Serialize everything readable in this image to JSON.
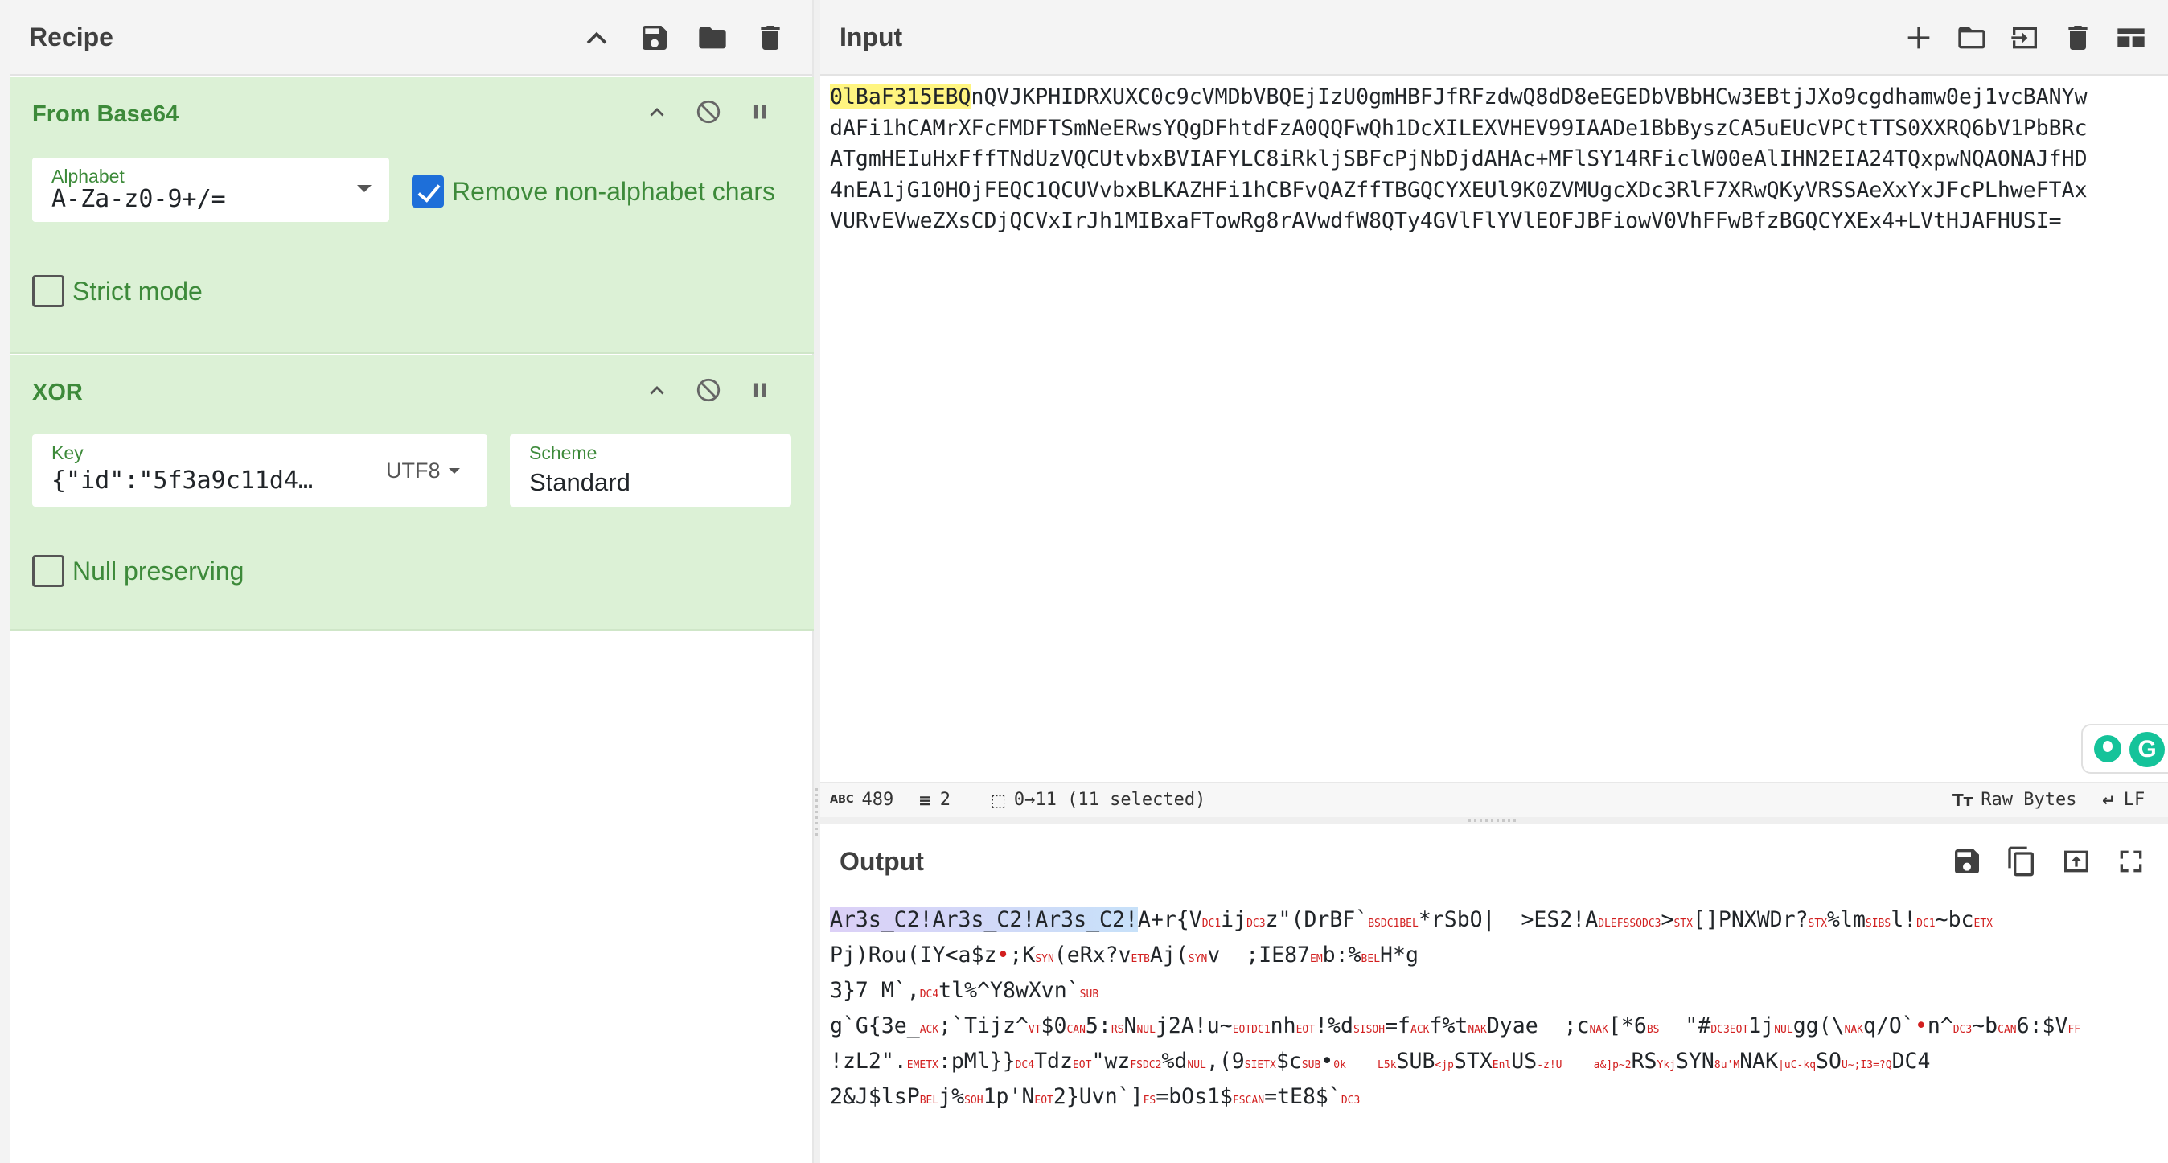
{
  "recipe": {
    "title": "Recipe",
    "operations": [
      {
        "name": "From Base64",
        "alphabet_label": "Alphabet",
        "alphabet_value": "A-Za-z0-9+/=",
        "remove_non_alphabet_label": "Remove non-alphabet chars",
        "remove_non_alphabet_checked": true,
        "strict_mode_label": "Strict mode",
        "strict_mode_checked": false
      },
      {
        "name": "XOR",
        "key_label": "Key",
        "key_value": "{\"id\":\"5f3a9c11d4…",
        "key_encoding": "UTF8",
        "scheme_label": "Scheme",
        "scheme_value": "Standard",
        "null_preserving_label": "Null preserving",
        "null_preserving_checked": false
      }
    ]
  },
  "input": {
    "title": "Input",
    "highlighted": "0lBaF315EBQ",
    "first_line_rest": "nQVJKPHIDRXUXC0c9cVMDbVBQEjIzU0gmHBFJfRFzdwQ8dD8eEGEDbVBbHCw3EBtjJXo9cgdhamw0ej1vcBANYw",
    "lines": [
      "dAFi1hCAMrXFcFMDFTSmNeERwsYQgDFhtdFzA0QQFwQh1DcXILEXVHEV99IAADe1BbByszCA5uEUcVPCtTTS0XXRQ6bV1PbBRc",
      "ATgmHEIuHxFffTNdUzVQCUtvbxBVIAFYLC8iRkljSBFcPjNbDjdAHAc+MFlSY14RFiclW00eAlIHN2EIA24TQxpwNQAONAJfHD",
      "4nEA1jG10HOjFEQC1QCUVvbxBLKAZHFi1hCBFvQAZffTBGQCYXEUl9K0ZVMUgcXDc3RlF7XRwQKyVRSSAeXxYxJFcPLhweFTAx",
      "VURvEVweZXsCDjQCVxIrJh1MIBxaFTowRg8rAVwdfW8QTy4GVlFlYVlEOFJBFiowV0VhFFwBfzBGQCYXEx4+LVtHJAFHUSI="
    ],
    "status": {
      "char_count": "489",
      "line_count": "2",
      "selection": "0→11 (11 selected)",
      "encoding_label": "Raw Bytes",
      "eol_label": "LF"
    }
  },
  "output": {
    "title": "Output",
    "highlighted": "Ar3s_C2!Ar3s_C2!Ar3s_C2!",
    "lines": [
      [
        "A+r{V",
        "DC1",
        "ij",
        "DC3",
        "z\"(DrBF`",
        "BSDC1BEL",
        "*rSbO|  >ES2!A",
        "DLEFSSODC3",
        ">",
        "STX",
        "[]PNXWDr?",
        "STX",
        "%lm",
        "SIBS",
        "l!",
        "DC1",
        "~bc",
        "ETX"
      ],
      [
        "Pj)Rou(IY<a$z",
        "•",
        ";K",
        "SYN",
        "(eRx?v",
        "ETB",
        "Aj(",
        "SYN",
        "v  ;IE87",
        "EM",
        "b:%",
        "BEL",
        "H*g"
      ],
      [
        "3}7 M`,",
        "DC4",
        "tl%^Y8wXvn`",
        "SUB"
      ],
      [
        "g`G{3e_",
        "ACK",
        ";`Tijz^",
        "VT",
        "$0",
        "CAN",
        "5:",
        "RS",
        "N",
        "NUL",
        "j2A!u~",
        "EOTDC1",
        "nh",
        "EOT",
        "!%d",
        "SISOH",
        "=f",
        "ACK",
        "f%t",
        "NAK",
        "Dyae  ;c",
        "NAK",
        "[*6",
        "BS",
        "  \"#",
        "DC3EOT",
        "1j",
        "NUL",
        "gg(\\",
        "NAK",
        "q/O`",
        "•",
        "n^",
        "DC3",
        "~b",
        "CAN",
        "6:$V",
        "FF"
      ],
      [
        "!zL2\".",
        "EMETX",
        ":pMl}}",
        "DC4",
        "Tdz",
        "EOT",
        "\"wz",
        "FSDC2",
        "%d",
        "NUL",
        ",(9",
        "SIETX",
        "$c",
        "SUB",
        "•",
        "0k     L5k",
        "SUB",
        "<jp",
        "STX",
        "Enl",
        "US",
        "-z!U     a&]p~2",
        "RS",
        "Ykj",
        "SYN",
        "8u'M",
        "NAK",
        "|uC-kq",
        "SO",
        "U~;I3=?Q",
        "DC4"
      ],
      [
        "2&J$lsP",
        "BEL",
        "j%",
        "SOH",
        "1p'N",
        "EOT",
        "2}Uvn`]",
        "FS",
        "=bOs1$",
        "FSCAN",
        "=tE8$`",
        "DC3"
      ]
    ]
  },
  "icons": {
    "recipe": [
      "chevron-up-icon",
      "save-icon",
      "folder-icon",
      "trash-icon"
    ],
    "operation": [
      "chevron-up-icon",
      "disable-icon",
      "pause-icon"
    ],
    "input": [
      "plus-icon",
      "folder-icon",
      "import-file-icon",
      "trash-icon",
      "layout-icon"
    ],
    "output": [
      "save-icon",
      "copy-icon",
      "replace-input-icon",
      "maximize-icon"
    ]
  },
  "colors": {
    "operation_bg": "#dcf1d6",
    "operation_text": "#3d8a3a",
    "input_highlight": "#fff580",
    "output_highlight": "#c7e1f9",
    "control_char": "#d21f1f",
    "checkbox_checked": "#1e6fd9"
  }
}
